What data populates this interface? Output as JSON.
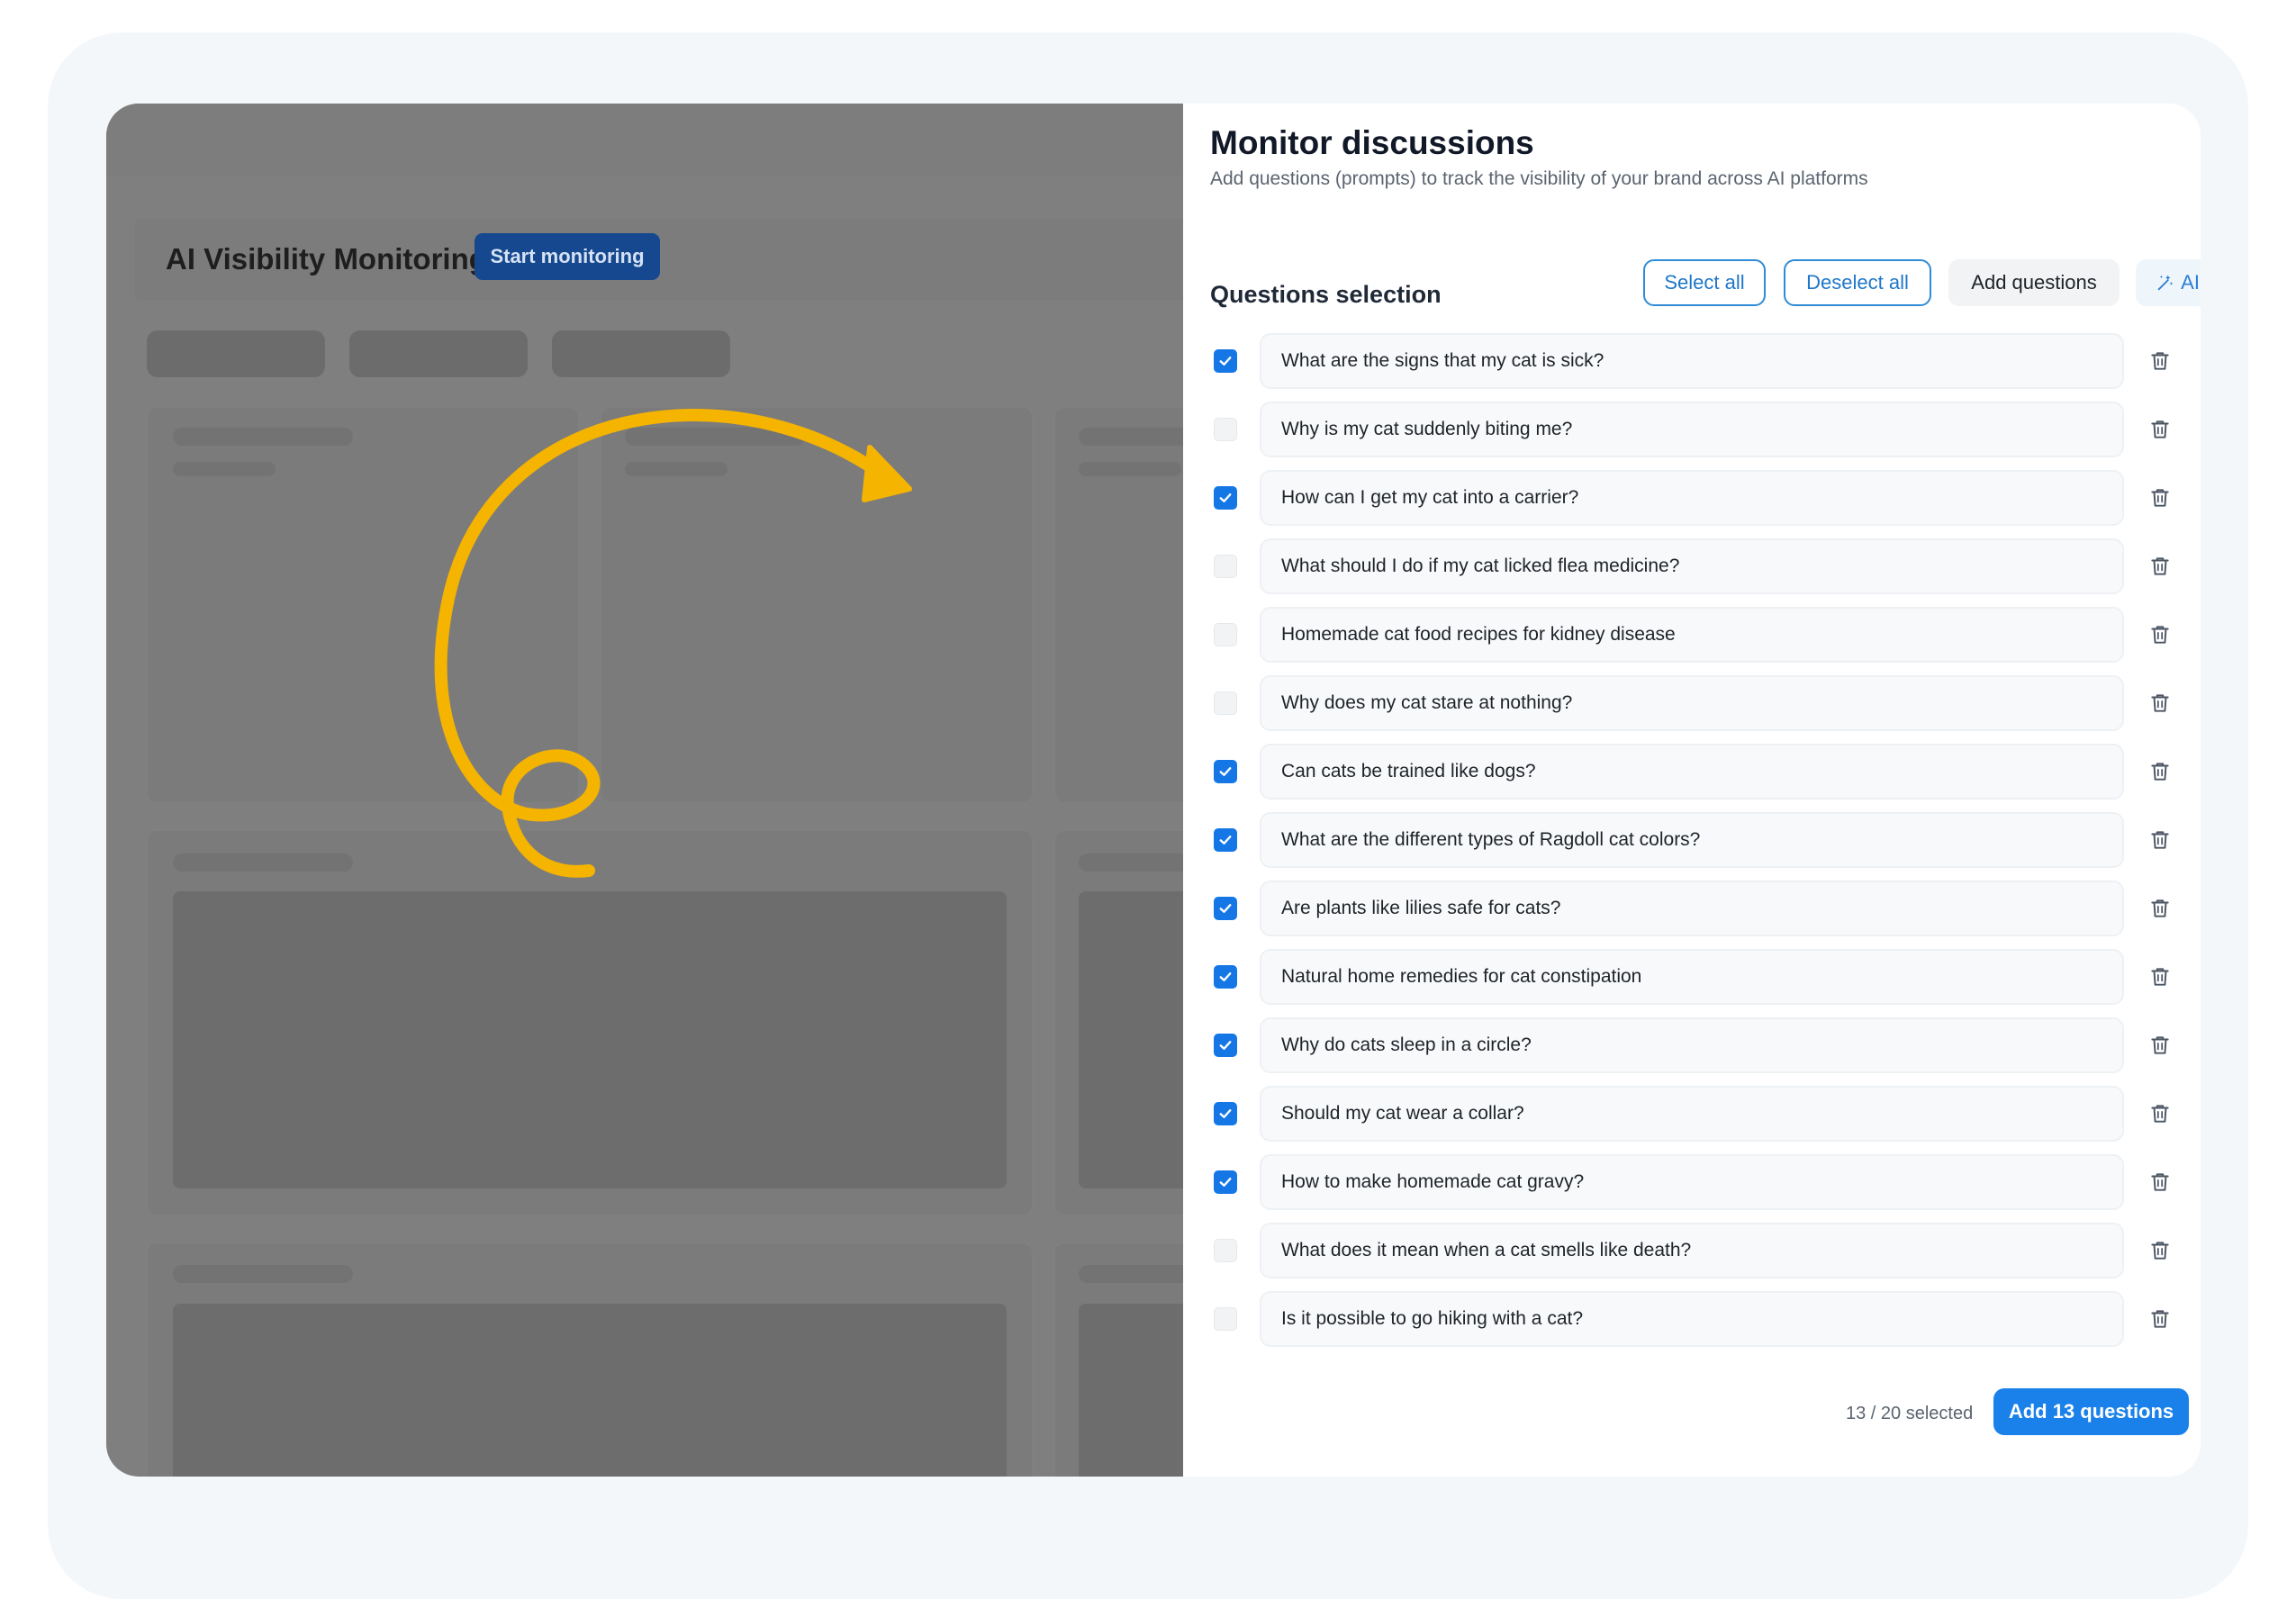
{
  "background_app": {
    "title": "AI Visibility Monitoring",
    "start_button": "Start monitoring"
  },
  "panel": {
    "title": "Monitor discussions",
    "subtitle": "Add questions (prompts) to track the visibility of your brand across AI platforms",
    "section_title": "Questions selection",
    "toolbar": {
      "select_all": "Select all",
      "deselect_all": "Deselect all",
      "add_questions": "Add questions",
      "ai_suggest": "AI Suggest"
    },
    "questions": [
      {
        "text": "What are the signs that my cat is sick?",
        "checked": true
      },
      {
        "text": "Why is my cat suddenly biting me?",
        "checked": false
      },
      {
        "text": "How can I get my cat into a carrier?",
        "checked": true
      },
      {
        "text": "What should I do if my cat licked flea medicine?",
        "checked": false
      },
      {
        "text": "Homemade cat food recipes for kidney disease",
        "checked": false
      },
      {
        "text": "Why does my cat stare at nothing?",
        "checked": false
      },
      {
        "text": "Can cats be trained like dogs?",
        "checked": true
      },
      {
        "text": "What are the different types of Ragdoll cat colors?",
        "checked": true
      },
      {
        "text": "Are plants like lilies safe for cats?",
        "checked": true
      },
      {
        "text": "Natural home remedies for cat constipation",
        "checked": true
      },
      {
        "text": "Why do cats sleep in a circle?",
        "checked": true
      },
      {
        "text": "Should my cat wear a collar?",
        "checked": true
      },
      {
        "text": "How to make homemade cat gravy?",
        "checked": true
      },
      {
        "text": "What does it mean when a cat smells like death?",
        "checked": false
      },
      {
        "text": "Is it possible to go hiking with a cat?",
        "checked": false
      }
    ],
    "footer": {
      "selected_count": "13 / 20 selected",
      "primary_button": "Add 13 questions"
    }
  },
  "colors": {
    "accent": "#1a80ea",
    "checkbox_checked": "#1577e6",
    "arrow": "#f5b400",
    "overlay": "#7f7f7f"
  },
  "icons": [
    "checkmark-icon",
    "trash-icon",
    "magic-wand-icon",
    "curved-arrow-illustration"
  ]
}
